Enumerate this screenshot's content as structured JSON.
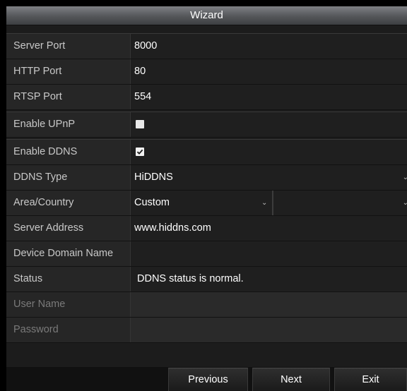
{
  "window": {
    "title": "Wizard"
  },
  "fields": {
    "server_port": {
      "label": "Server Port",
      "value": "8000"
    },
    "http_port": {
      "label": "HTTP Port",
      "value": "80"
    },
    "rtsp_port": {
      "label": "RTSP Port",
      "value": "554"
    },
    "enable_upnp": {
      "label": "Enable UPnP",
      "checked": false
    },
    "enable_ddns": {
      "label": "Enable DDNS",
      "checked": true
    },
    "ddns_type": {
      "label": "DDNS Type",
      "value": "HiDDNS"
    },
    "area_country": {
      "label": "Area/Country",
      "value": "Custom",
      "value2": ""
    },
    "server_address": {
      "label": "Server Address",
      "value": "www.hiddns.com"
    },
    "device_domain_name": {
      "label": "Device Domain Name",
      "value": ""
    },
    "status": {
      "label": "Status",
      "value": "DDNS status is normal."
    },
    "user_name": {
      "label": "User Name",
      "value": ""
    },
    "password": {
      "label": "Password",
      "value": ""
    }
  },
  "icons": {
    "dropdown": "chevron-down-icon",
    "check": "checkmark-icon"
  },
  "buttons": {
    "previous": "Previous",
    "next": "Next",
    "exit": "Exit"
  }
}
